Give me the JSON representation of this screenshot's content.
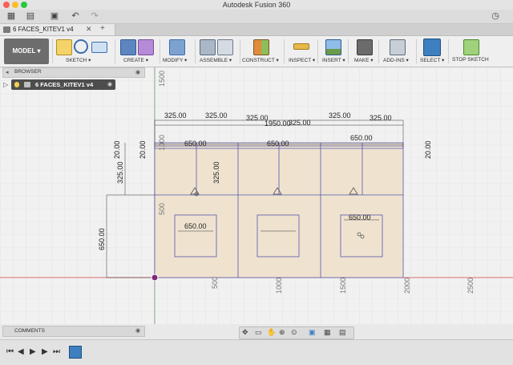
{
  "window": {
    "title": "Autodesk Fusion 360"
  },
  "document_tab": {
    "label": "6 FACES_KITEV1 v4"
  },
  "ribbon": {
    "workspace": "MODEL",
    "groups": [
      "SKETCH",
      "CREATE",
      "MODIFY",
      "ASSEMBLE",
      "CONSTRUCT",
      "INSPECT",
      "INSERT",
      "MAKE",
      "ADD-INS",
      "SELECT",
      "STOP SKETCH"
    ]
  },
  "browser": {
    "title": "BROWSER",
    "root_item": "6 FACES_KITEV1 v4"
  },
  "comments": {
    "title": "COMMENTS"
  },
  "canvas": {
    "dimensions": {
      "d325_1": "325.00",
      "d325_2": "325.00",
      "d325_3": "325.00",
      "d325_4": "325.00",
      "d325_5": "325.00",
      "d325_6": "325.00",
      "d325_v1": "325.00",
      "d325_v2": "325.00",
      "d1950": "1950.00",
      "d650_1": "650.00",
      "d650_2": "650.00",
      "d650_3": "650.00",
      "d650_4": "650.00",
      "d650_5": "650.00",
      "d650_v": "650.00",
      "d20_1": "20.00",
      "d20_2": "20.00",
      "d20_3": "20.00"
    },
    "ruler": {
      "x": [
        "500",
        "1000",
        "1500",
        "2000",
        "2500"
      ],
      "y": [
        "1500",
        "1000",
        "500"
      ]
    }
  },
  "colors": {
    "accent": "#3d7fbf",
    "sketch_line": "#5555aa",
    "face_fill": "#efe3d0",
    "x_axis": "#d04040"
  }
}
